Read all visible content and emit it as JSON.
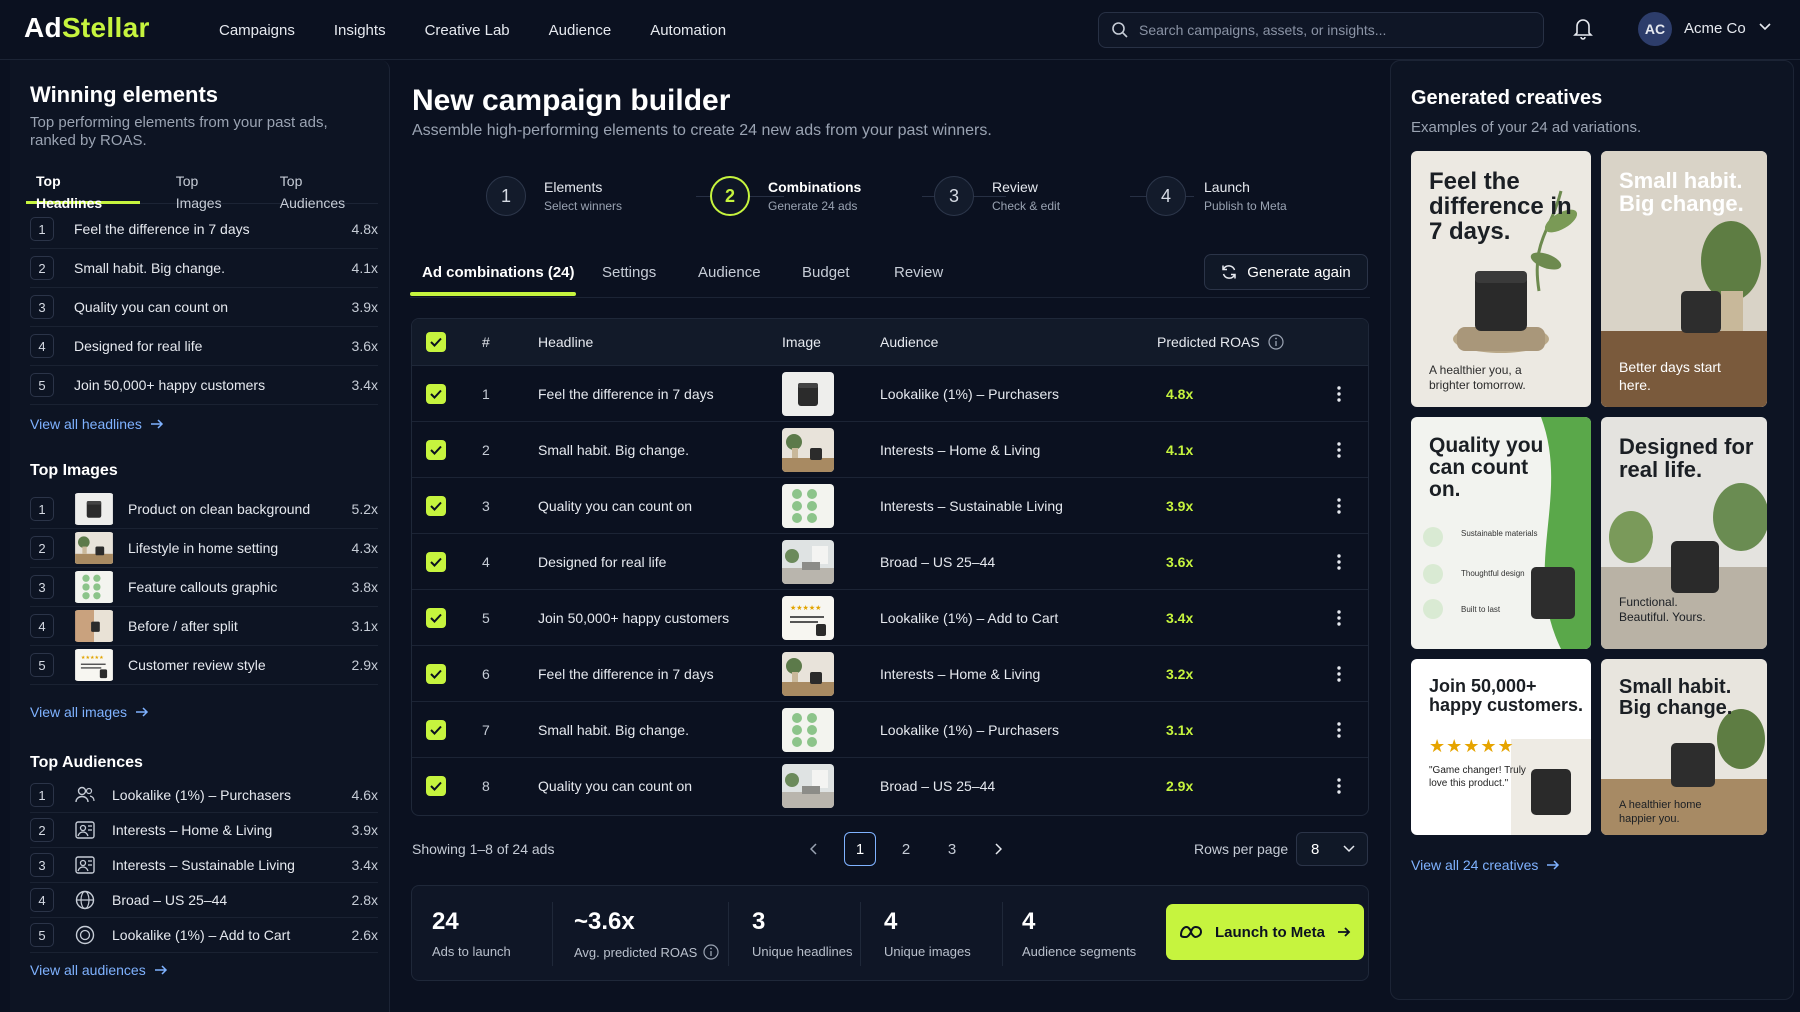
{
  "topbar": {
    "logo_a": "Ad",
    "logo_b": "Stellar",
    "nav": [
      "Campaigns",
      "Insights",
      "Creative Lab",
      "Audience",
      "Automation"
    ],
    "search_placeholder": "Search campaigns, assets, or insights...",
    "avatar_initials": "AC",
    "account_name": "Acme Co"
  },
  "left": {
    "title": "Winning elements",
    "subtitle": "Top performing elements from your past ads, ranked by ROAS.",
    "tabs": [
      "Top Headlines",
      "Top Images",
      "Top Audiences"
    ],
    "headlines": [
      {
        "rank": "1",
        "label": "Feel the difference in 7 days",
        "value": "4.8x"
      },
      {
        "rank": "2",
        "label": "Small habit. Big change.",
        "value": "4.1x"
      },
      {
        "rank": "3",
        "label": "Quality you can count on",
        "value": "3.9x"
      },
      {
        "rank": "4",
        "label": "Designed for real life",
        "value": "3.6x"
      },
      {
        "rank": "5",
        "label": "Join 50,000+ happy customers",
        "value": "3.4x"
      }
    ],
    "view_headlines": "View all headlines",
    "images_title": "Top Images",
    "images": [
      {
        "rank": "1",
        "label": "Product on clean background",
        "value": "5.2x"
      },
      {
        "rank": "2",
        "label": "Lifestyle in home setting",
        "value": "4.3x"
      },
      {
        "rank": "3",
        "label": "Feature callouts graphic",
        "value": "3.8x"
      },
      {
        "rank": "4",
        "label": "Before / after split",
        "value": "3.1x"
      },
      {
        "rank": "5",
        "label": "Customer review style",
        "value": "2.9x"
      }
    ],
    "view_images": "View all images",
    "audiences_title": "Top Audiences",
    "audiences": [
      {
        "rank": "1",
        "label": "Lookalike (1%) – Purchasers",
        "value": "4.6x",
        "icon": "users-icon"
      },
      {
        "rank": "2",
        "label": "Interests – Home & Living",
        "value": "3.9x",
        "icon": "interests-icon"
      },
      {
        "rank": "3",
        "label": "Interests – Sustainable Living",
        "value": "3.4x",
        "icon": "interests-icon"
      },
      {
        "rank": "4",
        "label": "Broad – US 25–44",
        "value": "2.8x",
        "icon": "globe-icon"
      },
      {
        "rank": "5",
        "label": "Lookalike (1%) – Add to Cart",
        "value": "2.6x",
        "icon": "target-icon"
      }
    ],
    "view_audiences": "View all audiences"
  },
  "center": {
    "title": "New campaign builder",
    "subtitle": "Assemble high-performing elements to create 24 new ads from your past winners.",
    "steps": [
      {
        "num": "1",
        "name": "Elements",
        "desc": "Select winners"
      },
      {
        "num": "2",
        "name": "Combinations",
        "desc": "Generate 24 ads"
      },
      {
        "num": "3",
        "name": "Review",
        "desc": "Check & edit"
      },
      {
        "num": "4",
        "name": "Launch",
        "desc": "Publish to Meta"
      }
    ],
    "tabs": [
      "Ad combinations (24)",
      "Settings",
      "Audience",
      "Budget",
      "Review"
    ],
    "generate_again": "Generate again",
    "table_headers": {
      "num": "#",
      "headline": "Headline",
      "image": "Image",
      "audience": "Audience",
      "roas": "Predicted ROAS"
    },
    "rows": [
      {
        "num": "1",
        "headline": "Feel the difference in 7 days",
        "image": "product",
        "audience": "Lookalike (1%) – Purchasers",
        "roas": "4.8x"
      },
      {
        "num": "2",
        "headline": "Small habit. Big change.",
        "image": "lifestyle",
        "audience": "Interests – Home & Living",
        "roas": "4.1x"
      },
      {
        "num": "3",
        "headline": "Quality you can count on",
        "image": "callouts",
        "audience": "Interests – Sustainable Living",
        "roas": "3.9x"
      },
      {
        "num": "4",
        "headline": "Designed for real life",
        "image": "room",
        "audience": "Broad – US 25–44",
        "roas": "3.6x"
      },
      {
        "num": "5",
        "headline": "Join 50,000+ happy customers",
        "image": "review",
        "audience": "Lookalike (1%) – Add to Cart",
        "roas": "3.4x"
      },
      {
        "num": "6",
        "headline": "Feel the difference in 7 days",
        "image": "lifestyle",
        "audience": "Interests – Home & Living",
        "roas": "3.2x"
      },
      {
        "num": "7",
        "headline": "Small habit. Big change.",
        "image": "callouts",
        "audience": "Lookalike (1%) – Purchasers",
        "roas": "3.1x"
      },
      {
        "num": "8",
        "headline": "Quality you can count on",
        "image": "room",
        "audience": "Broad – US 25–44",
        "roas": "2.9x"
      }
    ],
    "showing": "Showing 1–8 of 24 ads",
    "pages": [
      "1",
      "2",
      "3"
    ],
    "rows_per_page_label": "Rows per page",
    "rows_per_page": "8",
    "summary": [
      {
        "big": "24",
        "small": "Ads to launch"
      },
      {
        "big": "~3.6x",
        "small": "Avg. predicted ROAS"
      },
      {
        "big": "3",
        "small": "Unique headlines"
      },
      {
        "big": "4",
        "small": "Unique images"
      },
      {
        "big": "4",
        "small": "Audience segments"
      }
    ],
    "launch": "Launch to Meta"
  },
  "right": {
    "title": "Generated creatives",
    "subtitle": "Examples of your 24 ad variations.",
    "cards": [
      {
        "headline": "Feel the difference in 7 days.",
        "footer": "A healthier you, a brighter tomorrow."
      },
      {
        "headline": "Small habit. Big change.",
        "footer": "Better days start here."
      },
      {
        "headline": "Quality you can count on.",
        "callouts": [
          "Sustainable materials",
          "Thoughtful design",
          "Built to last"
        ]
      },
      {
        "headline": "Designed for real life.",
        "footer": "Functional. Beautiful. Yours."
      },
      {
        "headline": "Join 50,000+ happy customers.",
        "stars": "★★★★★",
        "footer": "\"Game changer! Truly love this product.\""
      },
      {
        "headline": "Small habit. Big change.",
        "footer": "A healthier home happier you."
      }
    ],
    "view_all": "View all 24 creatives"
  },
  "colors": {
    "accent": "#c6f43e",
    "link": "#7fb2ff",
    "bg": "#0b1120"
  }
}
